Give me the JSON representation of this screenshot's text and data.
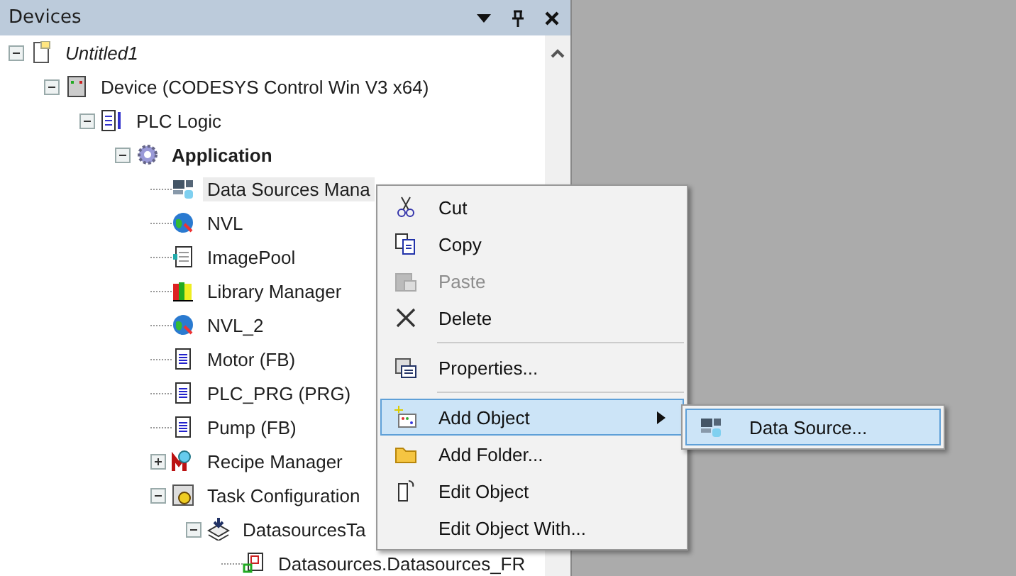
{
  "panel": {
    "title": "Devices"
  },
  "tree": [
    {
      "label": "Untitled1",
      "kind": "project",
      "italic": true,
      "expanded": true,
      "selected": false,
      "children": [
        {
          "label": "Device (CODESYS Control Win V3 x64)",
          "kind": "device",
          "expanded": true,
          "selected": false,
          "children": [
            {
              "label": "PLC Logic",
              "kind": "plc",
              "expanded": true,
              "selected": false,
              "children": [
                {
                  "label": "Application",
                  "kind": "gear",
                  "bold": true,
                  "expanded": true,
                  "selected": false,
                  "children": [
                    {
                      "label": "Data Sources Mana",
                      "kind": "datasource",
                      "selected": true
                    },
                    {
                      "label": "NVL",
                      "kind": "globe",
                      "selected": false
                    },
                    {
                      "label": "ImagePool",
                      "kind": "imagepool",
                      "selected": false
                    },
                    {
                      "label": "Library Manager",
                      "kind": "books",
                      "selected": false
                    },
                    {
                      "label": "NVL_2",
                      "kind": "globe",
                      "selected": false
                    },
                    {
                      "label": "Motor (FB)",
                      "kind": "doc",
                      "selected": false
                    },
                    {
                      "label": "PLC_PRG (PRG)",
                      "kind": "doc",
                      "selected": false
                    },
                    {
                      "label": "Pump (FB)",
                      "kind": "doc",
                      "selected": false
                    },
                    {
                      "label": "Recipe Manager",
                      "kind": "recipe",
                      "expanded": false,
                      "selected": false
                    },
                    {
                      "label": "Task Configuration",
                      "kind": "task",
                      "expanded": true,
                      "selected": false,
                      "children": [
                        {
                          "label": "DatasourcesTa",
                          "kind": "stack",
                          "expanded": true,
                          "selected": false,
                          "children": [
                            {
                              "label": "Datasources.Datasources_FR",
                              "kind": "pou",
                              "selected": false
                            }
                          ]
                        }
                      ]
                    }
                  ]
                }
              ]
            }
          ]
        }
      ]
    }
  ],
  "context_menu": [
    {
      "kind": "scissors",
      "label": "Cut",
      "disabled": false,
      "selected": false
    },
    {
      "kind": "copy",
      "label": "Copy",
      "disabled": false,
      "selected": false
    },
    {
      "kind": "paste",
      "label": "Paste",
      "disabled": true,
      "selected": false
    },
    {
      "kind": "delete",
      "label": "Delete",
      "disabled": false,
      "selected": false
    },
    {
      "kind": "separator"
    },
    {
      "kind": "properties",
      "label": "Properties...",
      "disabled": false,
      "selected": false
    },
    {
      "kind": "separator"
    },
    {
      "kind": "addobject",
      "label": "Add Object",
      "disabled": false,
      "selected": true,
      "submenu": [
        {
          "label": "Data Source...",
          "kind": "datasource",
          "selected": true
        }
      ]
    },
    {
      "kind": "folder",
      "label": "Add Folder...",
      "disabled": false,
      "selected": false
    },
    {
      "kind": "editobject",
      "label": "Edit Object",
      "disabled": false,
      "selected": false
    },
    {
      "kind": "plain",
      "label": "Edit Object With...",
      "disabled": false,
      "selected": false
    }
  ]
}
